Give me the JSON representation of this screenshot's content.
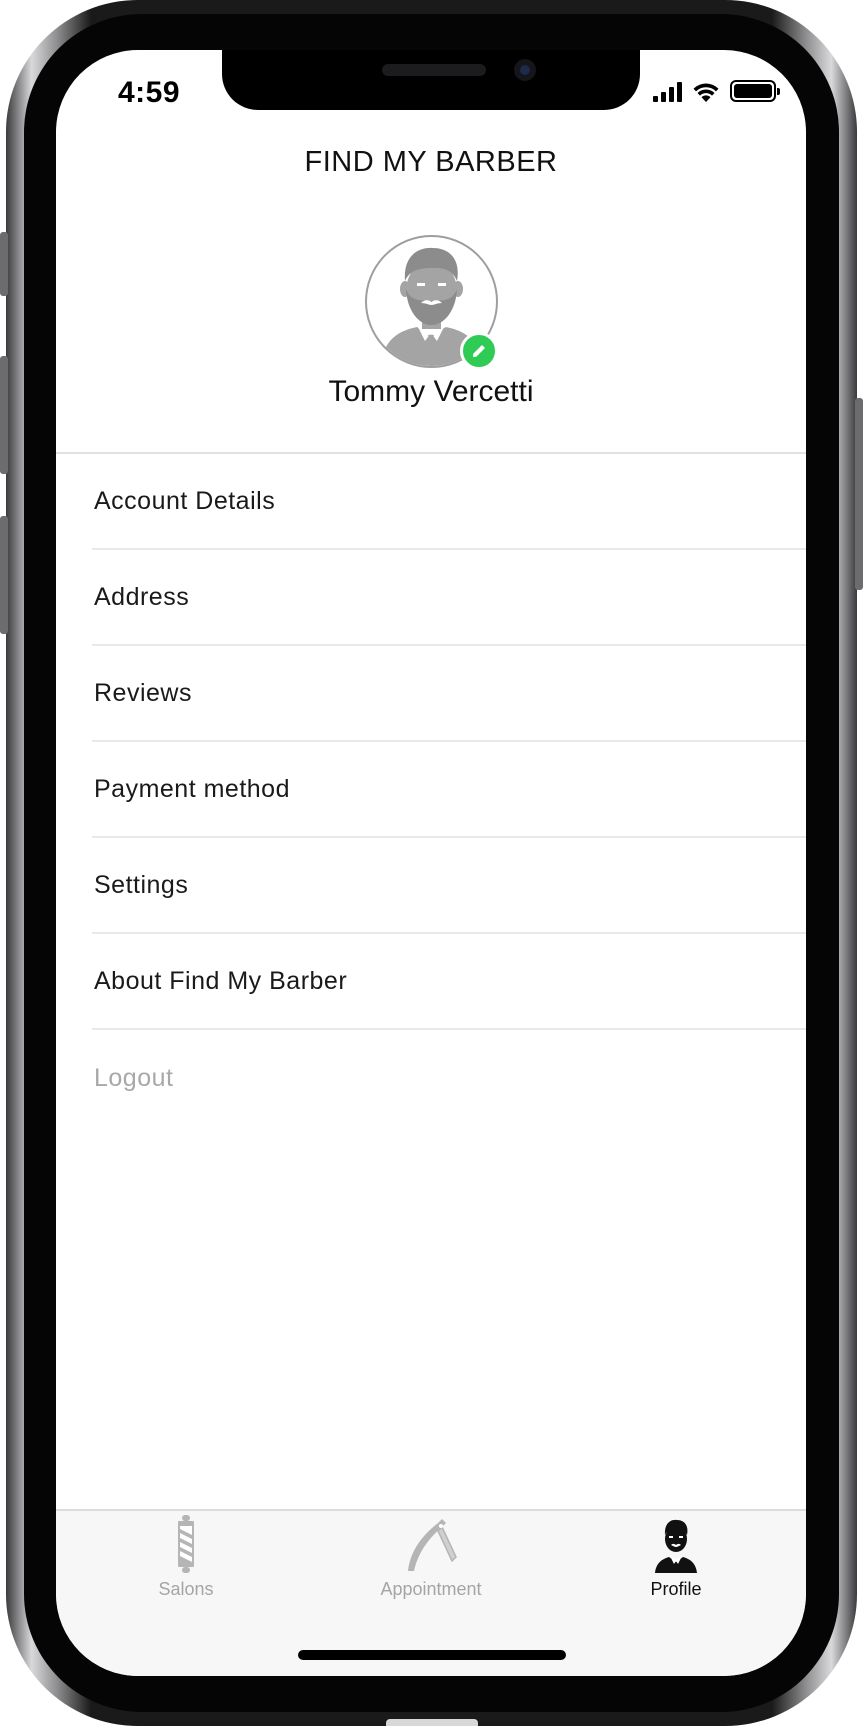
{
  "status_bar": {
    "time": "4:59"
  },
  "header": {
    "title": "FIND MY BARBER"
  },
  "profile": {
    "name": "Tommy Vercetti",
    "avatar_icon": "bearded-man-avatar-icon",
    "edit_icon": "pencil-icon",
    "edit_badge_color": "#2ecc54"
  },
  "menu": {
    "items": [
      {
        "label": "Account Details"
      },
      {
        "label": "Address"
      },
      {
        "label": "Reviews"
      },
      {
        "label": "Payment method"
      },
      {
        "label": "Settings"
      },
      {
        "label": "About Find My Barber"
      },
      {
        "label": "Logout"
      }
    ]
  },
  "tab_bar": {
    "tabs": [
      {
        "label": "Salons",
        "icon": "barber-pole-icon",
        "active": false
      },
      {
        "label": "Appointment",
        "icon": "straight-razor-icon",
        "active": false
      },
      {
        "label": "Profile",
        "icon": "bearded-man-icon",
        "active": true
      }
    ],
    "active_color": "#111111",
    "inactive_color": "#a5a5a5"
  }
}
